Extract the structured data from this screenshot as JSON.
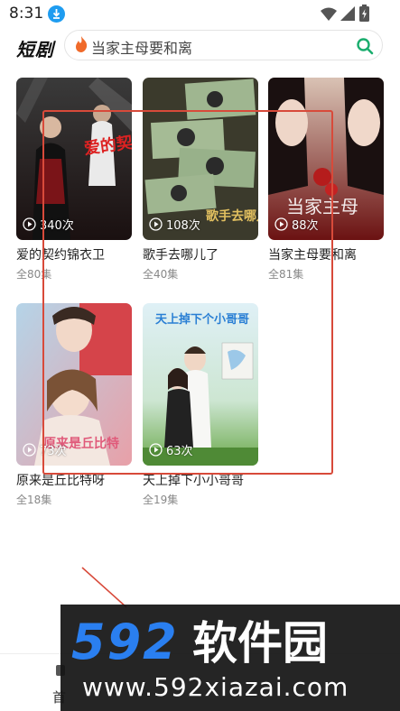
{
  "status_bar": {
    "time": "8:31",
    "icons": [
      "download-icon",
      "wifi-icon",
      "signal-icon",
      "battery-icon"
    ]
  },
  "header": {
    "brand": "短剧",
    "search_text": "当家主母要和离",
    "icons": [
      "fire-icon",
      "search-icon"
    ]
  },
  "dramas": [
    {
      "title": "爱的契约锦衣卫",
      "episodes": "全80集",
      "plays": "340次"
    },
    {
      "title": "歌手去哪儿了",
      "episodes": "全40集",
      "plays": "108次"
    },
    {
      "title": "当家主母要和离",
      "episodes": "全81集",
      "plays": "88次"
    },
    {
      "title": "原来是丘比特呀",
      "episodes": "全18集",
      "plays": "73次"
    },
    {
      "title": "天上掉下小小哥哥",
      "episodes": "全19集",
      "plays": "63次"
    }
  ],
  "posters": [
    {
      "text": "爱的契约锦衣卫"
    },
    {
      "text": "歌手去哪儿了"
    },
    {
      "text": "当家主母"
    },
    {
      "text": "原来是丘比特"
    },
    {
      "text": "天上掉下个小哥哥"
    }
  ],
  "bottom_nav": {
    "home_label": "首"
  },
  "watermark": {
    "logo_text": "592软件园",
    "url": "www.592xiazai.com"
  },
  "colors": {
    "accent_green": "#1aad6e",
    "download_blue": "#1e9cf0",
    "annotation_red": "#d84a3a",
    "watermark_blue": "#2a7ff0"
  }
}
